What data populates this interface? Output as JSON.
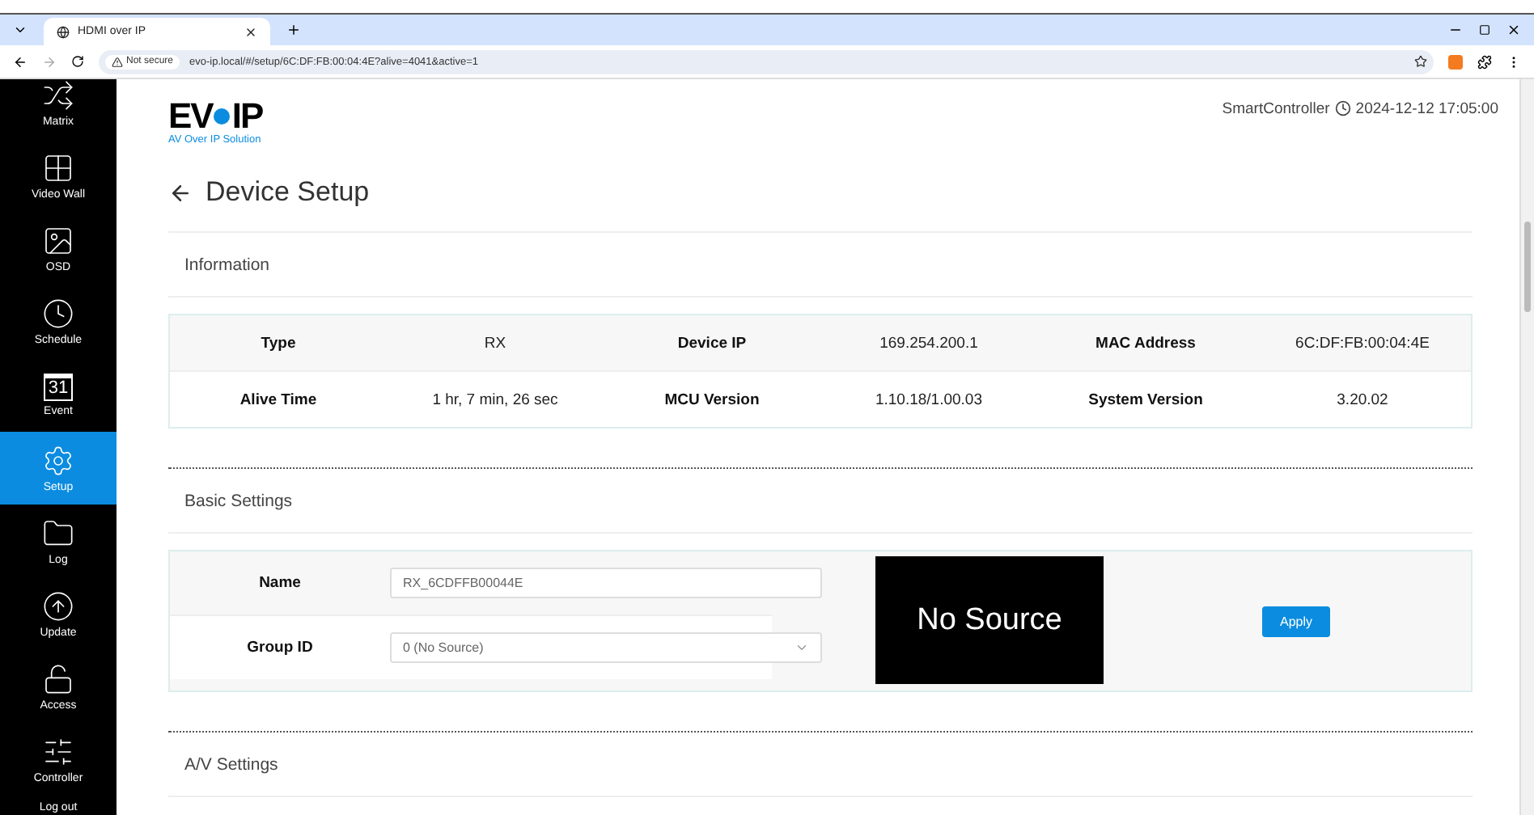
{
  "browser": {
    "tab_title": "HDMI over IP",
    "security": "Not secure",
    "url": "evo-ip.local/#/setup/6C:DF:FB:00:04:4E?alive=4041&active=1"
  },
  "sidebar": {
    "items": [
      {
        "kind": "matrix",
        "label": "Matrix",
        "selected": false
      },
      {
        "kind": "videowall",
        "label": "Video Wall",
        "selected": false
      },
      {
        "kind": "osd",
        "label": "OSD",
        "selected": false
      },
      {
        "kind": "schedule",
        "label": "Schedule",
        "selected": false
      },
      {
        "kind": "event",
        "label": "Event",
        "icon_text": "31",
        "selected": false
      },
      {
        "kind": "setup",
        "label": "Setup",
        "selected": true
      },
      {
        "kind": "log",
        "label": "Log",
        "selected": false
      },
      {
        "kind": "update",
        "label": "Update",
        "selected": false
      },
      {
        "kind": "access",
        "label": "Access",
        "selected": false
      },
      {
        "kind": "controller",
        "label": "Controller",
        "selected": false
      },
      {
        "kind": "logout",
        "label": "Log out",
        "selected": false
      }
    ]
  },
  "header": {
    "logo_left": "EV",
    "logo_right": "IP",
    "tagline": "AV Over IP Solution",
    "controller": "SmartController",
    "datetime": "2024-12-12 17:05:00"
  },
  "page_title": "Device Setup",
  "information": {
    "title": "Information",
    "rows": [
      [
        {
          "label": "Type",
          "value": "RX"
        },
        {
          "label": "Device IP",
          "value": "169.254.200.1"
        },
        {
          "label": "MAC Address",
          "value": "6C:DF:FB:00:04:4E"
        }
      ],
      [
        {
          "label": "Alive Time",
          "value": "1 hr, 7 min, 26 sec"
        },
        {
          "label": "MCU Version",
          "value": "1.10.18/1.00.03"
        },
        {
          "label": "System Version",
          "value": "3.20.02"
        }
      ]
    ]
  },
  "basic_settings": {
    "title": "Basic Settings",
    "name_label": "Name",
    "name_value": "RX_6CDFFB00044E",
    "group_label": "Group ID",
    "group_value": "0 (No Source)",
    "preview": "No Source",
    "apply": "Apply"
  },
  "av_settings": {
    "title": "A/V Settings"
  }
}
